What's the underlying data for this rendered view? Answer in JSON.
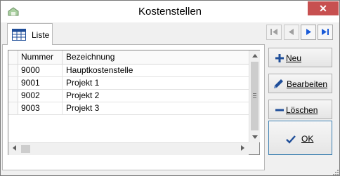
{
  "window": {
    "title": "Kostenstellen",
    "close_glyph": "✕"
  },
  "tabs": [
    {
      "label": "Liste",
      "icon": "table-icon"
    }
  ],
  "navigation": {
    "first": "first-record-icon",
    "prev": "previous-record-icon",
    "next": "next-record-icon",
    "last": "last-record-icon"
  },
  "table": {
    "columns": [
      "Nummer",
      "Bezeichnung"
    ],
    "rows": [
      {
        "nummer": "9000",
        "bezeichnung": "Hauptkostenstelle"
      },
      {
        "nummer": "9001",
        "bezeichnung": "Projekt 1"
      },
      {
        "nummer": "9002",
        "bezeichnung": "Projekt 2"
      },
      {
        "nummer": "9003",
        "bezeichnung": "Projekt 3"
      }
    ]
  },
  "buttons": {
    "neu": "Neu",
    "bearbeiten": "Bearbeiten",
    "loeschen": "Löschen",
    "ok": "OK"
  },
  "colors": {
    "accent": "#1a5bd8",
    "close": "#c75050",
    "ok_border": "#3c7fb1"
  }
}
